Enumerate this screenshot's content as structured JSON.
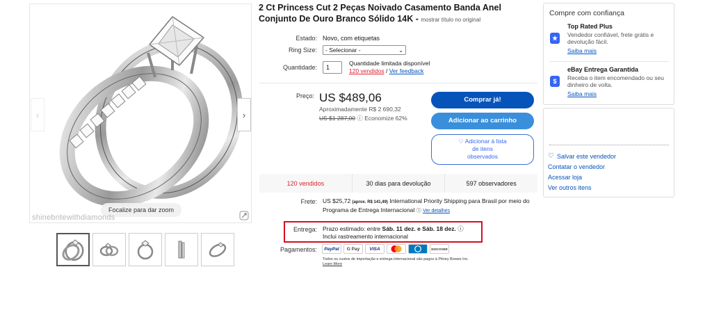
{
  "listing": {
    "title": "2 Ct Princess Cut 2 Peças Noivado Casamento Banda Anel Conjunto De Ouro Branco Sólido 14K -",
    "show_original": "mostrar título no original"
  },
  "gallery": {
    "zoom_hint": "Focalize para dar zoom",
    "watermark": "shinebritewithdiamonds",
    "prev": "‹",
    "next": "›",
    "thumb_count": 5
  },
  "details": {
    "condition_label": "Estado:",
    "condition_value": "Novo, com etiquetas",
    "ring_size_label": "Ring Size:",
    "ring_size_selected": "- Selecionar -",
    "quantity_label": "Quantidade:",
    "quantity_value": "1",
    "quantity_note": "Quantidade limitada disponível",
    "sold_link": "120 vendidos",
    "separator": "/",
    "feedback_link": "Ver feedback"
  },
  "price": {
    "label": "Preço:",
    "value": "US $489,06",
    "approx": "Aproximadamente R$ 2 690,32",
    "original": "US $1 287,00",
    "save_prefix": "ⓘ",
    "savings": "Economize 62%"
  },
  "buttons": {
    "buy_now": "Comprar já!",
    "add_to_cart": "Adicionar ao carrinho",
    "watch_line1": "♡ Adicionar à lista",
    "watch_line2": "de itens",
    "watch_line3": "observados"
  },
  "stats": {
    "sold": "120 vendidos",
    "returns": "30 dias para devolução",
    "watchers": "597 observadores"
  },
  "shipping": {
    "label": "Frete:",
    "cost": "US $25,72",
    "approx": "(aprox. R$ 141,49)",
    "method": "International Priority Shipping para Brasil",
    "via": "por meio do Programa de Entrega Internacional",
    "details_link": "Ver detalhes"
  },
  "delivery": {
    "label": "Entrega:",
    "prefix": "Prazo estimado: entre",
    "dates": "Sáb. 11 dez. e Sáb. 18 dez.",
    "tracking": "Inclui rastreamento internacional"
  },
  "payments": {
    "label": "Pagamentos:",
    "methods": [
      "PayPal",
      "G Pay",
      "VISA",
      "MC",
      "DC",
      "DISCOVER"
    ],
    "note": "Todos os custos de importação e entrega internacional são pagos à Pitney Bowes Inc.",
    "learn_more": "Learn More"
  },
  "trust": {
    "title": "Compre com confiança",
    "top_rated_head": "Top Rated Plus",
    "top_rated_desc": "Vendedor confiável, frete grátis e devolução fácil.",
    "top_rated_link": "Saiba mais",
    "guarantee_head": "eBay Entrega Garantida",
    "guarantee_desc": "Receba o item encomendado ou seu dinheiro de volta.",
    "guarantee_link": "Saiba mais"
  },
  "seller": {
    "save": "Salvar este vendedor",
    "contact": "Contatar o vendedor",
    "store": "Acessar loja",
    "other_items": "Ver outros itens"
  },
  "colors": {
    "primary_blue": "#0654ba",
    "cart_blue": "#3a8fdc",
    "highlight_red": "#d50e22",
    "sold_red": "#dd1e31"
  }
}
